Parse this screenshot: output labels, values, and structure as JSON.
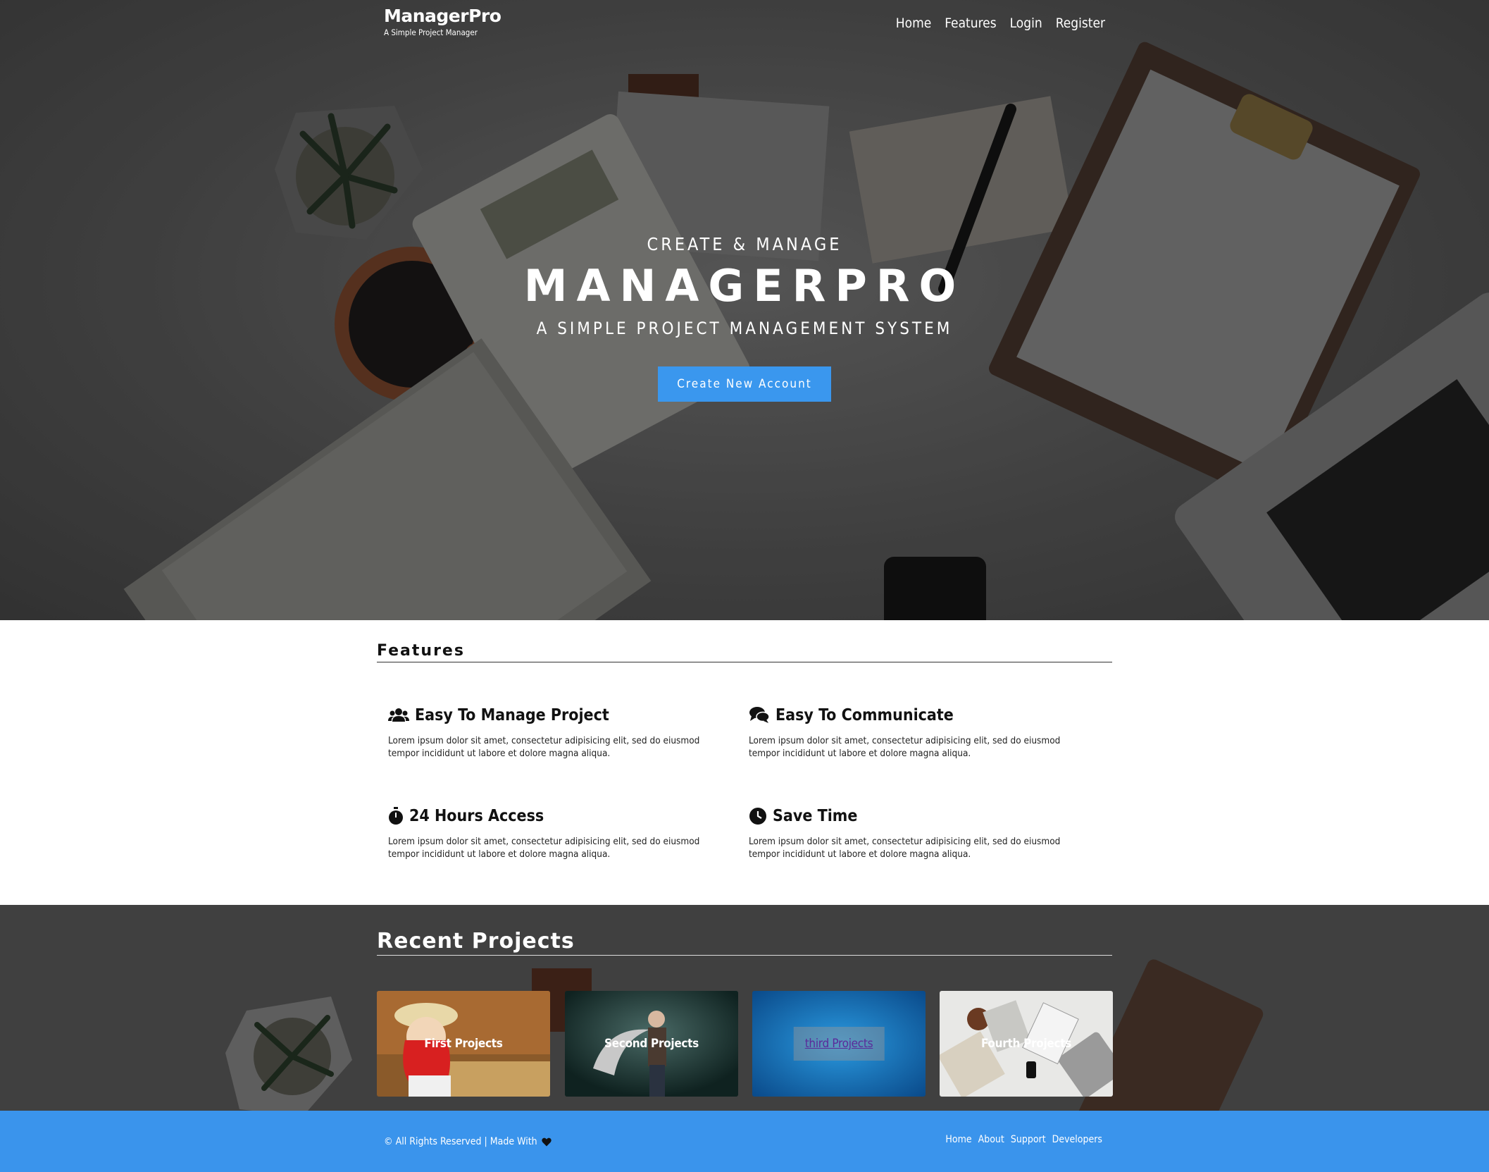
{
  "header": {
    "brand_title": "ManagerPro",
    "brand_subtitle": "A Simple Project Manager",
    "nav": [
      {
        "label": "Home"
      },
      {
        "label": "Features"
      },
      {
        "label": "Login"
      },
      {
        "label": "Register"
      }
    ]
  },
  "hero": {
    "kicker": "CREATE & MANAGE",
    "title": "MANAGERPRO",
    "tagline": "A SIMPLE PROJECT MANAGEMENT SYSTEM",
    "cta_label": "Create New Account",
    "cta_color": "#3a97ee"
  },
  "features": {
    "heading": "Features",
    "items": [
      {
        "icon": "users-icon",
        "title": "Easy To Manage Project",
        "text": "Lorem ipsum dolor sit amet, consectetur adipisicing elit, sed do eiusmod tempor incididunt ut labore et dolore magna aliqua."
      },
      {
        "icon": "comments-icon",
        "title": "Easy To Communicate",
        "text": "Lorem ipsum dolor sit amet, consectetur adipisicing elit, sed do eiusmod tempor incididunt ut labore et dolore magna aliqua."
      },
      {
        "icon": "stopwatch-icon",
        "title": "24 Hours Access",
        "text": "Lorem ipsum dolor sit amet, consectetur adipisicing elit, sed do eiusmod tempor incididunt ut labore et dolore magna aliqua."
      },
      {
        "icon": "clock-icon",
        "title": "Save Time",
        "text": "Lorem ipsum dolor sit amet, consectetur adipisicing elit, sed do eiusmod tempor incididunt ut labore et dolore magna aliqua."
      }
    ]
  },
  "recent": {
    "heading": "Recent Projects",
    "projects": [
      {
        "label": "First Projects"
      },
      {
        "label": "Second Projects"
      },
      {
        "label": "third Projects"
      },
      {
        "label": "Fourth Projects"
      }
    ]
  },
  "footer": {
    "copyright": "© All Rights Reserved | Made With",
    "links": [
      {
        "label": "Home"
      },
      {
        "label": "About"
      },
      {
        "label": "Support"
      },
      {
        "label": "Developers"
      }
    ],
    "color": "#3a94ec"
  }
}
